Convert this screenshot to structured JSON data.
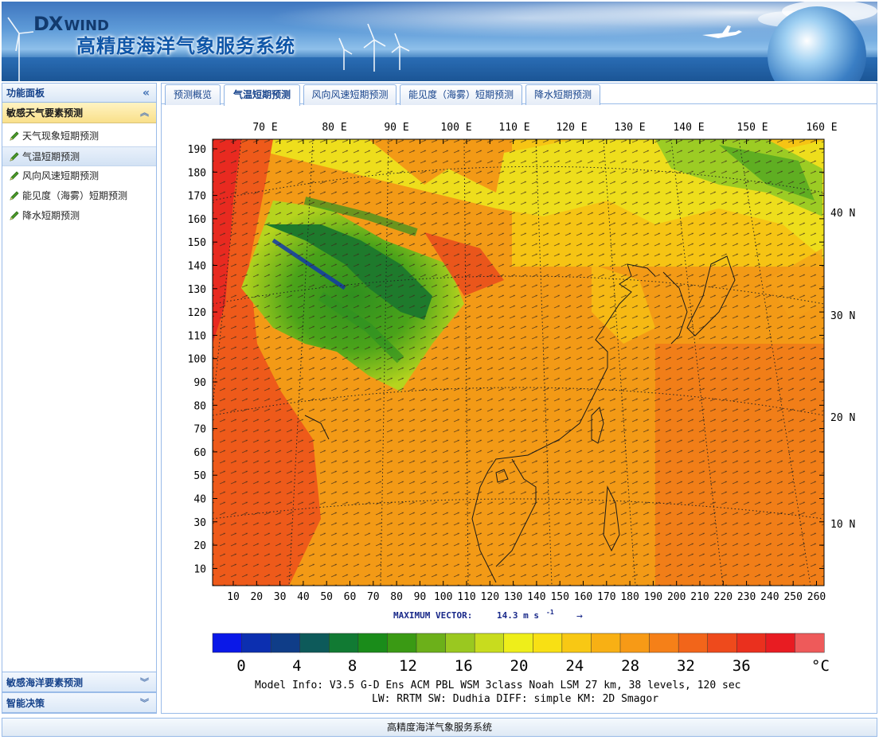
{
  "header": {
    "logo_dx": "DX",
    "logo_wind": "WIND",
    "title": "高精度海洋气象服务系统"
  },
  "sidebar": {
    "panel_title": "功能面板",
    "groups": [
      {
        "label": "敏感天气要素预测",
        "expanded": true,
        "items": [
          {
            "label": "天气现象短期预测"
          },
          {
            "label": "气温短期预测"
          },
          {
            "label": "风向风速短期预测"
          },
          {
            "label": "能见度（海雾）短期预测"
          },
          {
            "label": "降水短期预测"
          }
        ],
        "active_index": 1
      },
      {
        "label": "敏感海洋要素预测",
        "expanded": false
      },
      {
        "label": "智能决策",
        "expanded": false
      }
    ]
  },
  "tabs": [
    {
      "label": "预测概览",
      "active": false
    },
    {
      "label": "气温短期预测",
      "active": true
    },
    {
      "label": "风向风速短期预测",
      "active": false
    },
    {
      "label": "能见度（海雾）短期预测",
      "active": false
    },
    {
      "label": "降水短期预测",
      "active": false
    }
  ],
  "map": {
    "top_lon_labels": [
      "70 E",
      "80 E",
      "90 E",
      "100 E",
      "110 E",
      "120 E",
      "130 E",
      "140 E",
      "150 E",
      "160 E"
    ],
    "right_lat_labels": [
      "40 N",
      "30 N",
      "20 N",
      "10 N"
    ],
    "y_ticks": [
      "190",
      "180",
      "170",
      "160",
      "150",
      "140",
      "130",
      "120",
      "110",
      "100",
      "90",
      "80",
      "70",
      "60",
      "50",
      "40",
      "30",
      "20",
      "10"
    ],
    "x_ticks": [
      "10",
      "20",
      "30",
      "40",
      "50",
      "60",
      "70",
      "80",
      "90",
      "100",
      "110",
      "120",
      "130",
      "140",
      "150",
      "160",
      "170",
      "180",
      "190",
      "200",
      "210",
      "220",
      "230",
      "240",
      "250",
      "260"
    ],
    "max_vector_label": "MAXIMUM VECTOR:",
    "max_vector_value": "14.3 m s",
    "max_vector_exp": "-1",
    "max_vector_arrow": "→",
    "colorbar_ticks": [
      "0",
      "4",
      "8",
      "12",
      "16",
      "20",
      "24",
      "28",
      "32",
      "36"
    ],
    "colorbar_unit": "°C",
    "colorbar_colors": [
      "#0a18e8",
      "#0c2fb0",
      "#0f3d88",
      "#0d5a5a",
      "#117a33",
      "#1a8c1a",
      "#3a9a14",
      "#6cb01a",
      "#9ac820",
      "#c8dc1e",
      "#eeee1a",
      "#f8e014",
      "#f8c814",
      "#f8b014",
      "#f79a16",
      "#f58018",
      "#f2651a",
      "#ee4a1c",
      "#ea301e",
      "#e81c22",
      "#ee5a5a"
    ],
    "model_info_line1": "Model Info: V3.5    G-D Ens ACM PBL  WSM 3class  Noah LSM  27 km,   38 levels,  120 sec",
    "model_info_line2": "LW: RRTM SW: Dudhia  DIFF: simple KM: 2D Smagor"
  },
  "footer": {
    "text": "高精度海洋气象服务系统"
  },
  "colors": {
    "accent": "#15428b",
    "border": "#99bbe8",
    "active_group": "#f9e08a"
  }
}
